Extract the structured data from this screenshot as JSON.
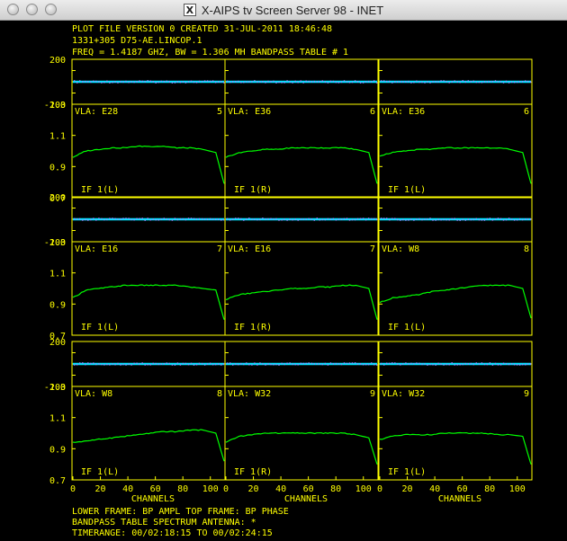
{
  "window": {
    "title": "X-AIPS tv Screen Server 98 - INET",
    "icon": "x11-icon",
    "buttons": [
      "close-button",
      "minimize-button",
      "zoom-button"
    ]
  },
  "header": {
    "line1": "PLOT FILE VERSION 0  CREATED 31-JUL-2011 18:46:48",
    "line2": "1331+305    D75-AE.LINCOP.1",
    "line3": "FREQ = 1.4187 GHZ, BW = 1.306 MH    BANDPASS TABLE # 1"
  },
  "footer": {
    "line1": "LOWER FRAME: BP AMPL    TOP FRAME: BP PHASE",
    "line2": "BANDPASS TABLE SPECTRUM     ANTENNA: *",
    "line3": "TIMERANGE: 00/02:18:15 TO 00/02:24:15"
  },
  "axes": {
    "phase_ticks": [
      "200",
      "-200"
    ],
    "amp_ticks": [
      "1.3",
      "1.1",
      "0.9",
      "0.7"
    ],
    "x_ticks": [
      "0",
      "20",
      "40",
      "60",
      "80",
      "100"
    ],
    "x_label": "CHANNELS"
  },
  "colors": {
    "background": "#000000",
    "frame": "#ffff00",
    "amplitude": "#00ff00",
    "phase": "#00e5ff",
    "phase_dots": "#9b7dff"
  },
  "chart_data": {
    "type": "line",
    "xlabel": "CHANNELS",
    "xlim": [
      0,
      110
    ],
    "phase_ylim": [
      -200,
      200
    ],
    "amp_ylim": [
      0.7,
      1.3
    ],
    "panels": [
      {
        "antenna": "VLA: E28",
        "number": "5",
        "if_label": "IF 1(L)",
        "phase": 0,
        "amp": [
          0.96,
          1.0,
          1.01,
          1.02,
          1.02,
          1.03,
          1.03,
          1.03,
          1.02,
          1.02,
          1.01,
          0.99,
          0.79
        ]
      },
      {
        "antenna": "VLA: E36",
        "number": "6",
        "if_label": "IF 1(R)",
        "phase": 0,
        "amp": [
          0.96,
          0.99,
          1.0,
          1.01,
          1.01,
          1.02,
          1.02,
          1.02,
          1.02,
          1.02,
          1.01,
          0.99,
          0.79
        ]
      },
      {
        "antenna": "VLA: E36",
        "number": "6",
        "if_label": "IF 1(L)",
        "phase": 0,
        "amp": [
          0.97,
          0.99,
          1.0,
          1.01,
          1.01,
          1.02,
          1.02,
          1.02,
          1.02,
          1.02,
          1.01,
          0.99,
          0.79
        ]
      },
      {
        "antenna": "VLA: E16",
        "number": "7",
        "if_label": "IF 1(L)",
        "phase": 0,
        "amp": [
          0.94,
          0.99,
          1.0,
          1.01,
          1.02,
          1.02,
          1.02,
          1.02,
          1.02,
          1.01,
          1.0,
          0.99,
          0.8
        ]
      },
      {
        "antenna": "VLA: E16",
        "number": "7",
        "if_label": "IF 1(R)",
        "phase": 0,
        "amp": [
          0.93,
          0.96,
          0.97,
          0.98,
          0.99,
          1.0,
          1.0,
          1.01,
          1.01,
          1.02,
          1.02,
          1.0,
          0.8
        ]
      },
      {
        "antenna": "VLA: W8",
        "number": "8",
        "if_label": "IF 1(L)",
        "phase": 0,
        "amp": [
          0.91,
          0.94,
          0.95,
          0.96,
          0.98,
          0.99,
          1.0,
          1.01,
          1.02,
          1.02,
          1.02,
          1.0,
          0.81
        ]
      },
      {
        "antenna": "VLA: W8",
        "number": "8",
        "if_label": "IF 1(L)",
        "phase": 0,
        "amp": [
          0.94,
          0.95,
          0.96,
          0.97,
          0.98,
          0.99,
          1.0,
          1.01,
          1.01,
          1.02,
          1.02,
          1.0,
          0.82
        ]
      },
      {
        "antenna": "VLA: W32",
        "number": "9",
        "if_label": "IF 1(R)",
        "phase": 0,
        "amp": [
          0.94,
          0.98,
          0.99,
          1.0,
          1.0,
          1.0,
          1.0,
          1.0,
          1.0,
          1.0,
          0.99,
          0.97,
          0.8
        ]
      },
      {
        "antenna": "VLA: W32",
        "number": "9",
        "if_label": "IF 1(L)",
        "phase": 0,
        "amp": [
          0.96,
          0.98,
          0.99,
          0.99,
          0.99,
          1.0,
          1.0,
          1.0,
          1.0,
          0.99,
          0.99,
          0.98,
          0.8
        ]
      }
    ]
  }
}
